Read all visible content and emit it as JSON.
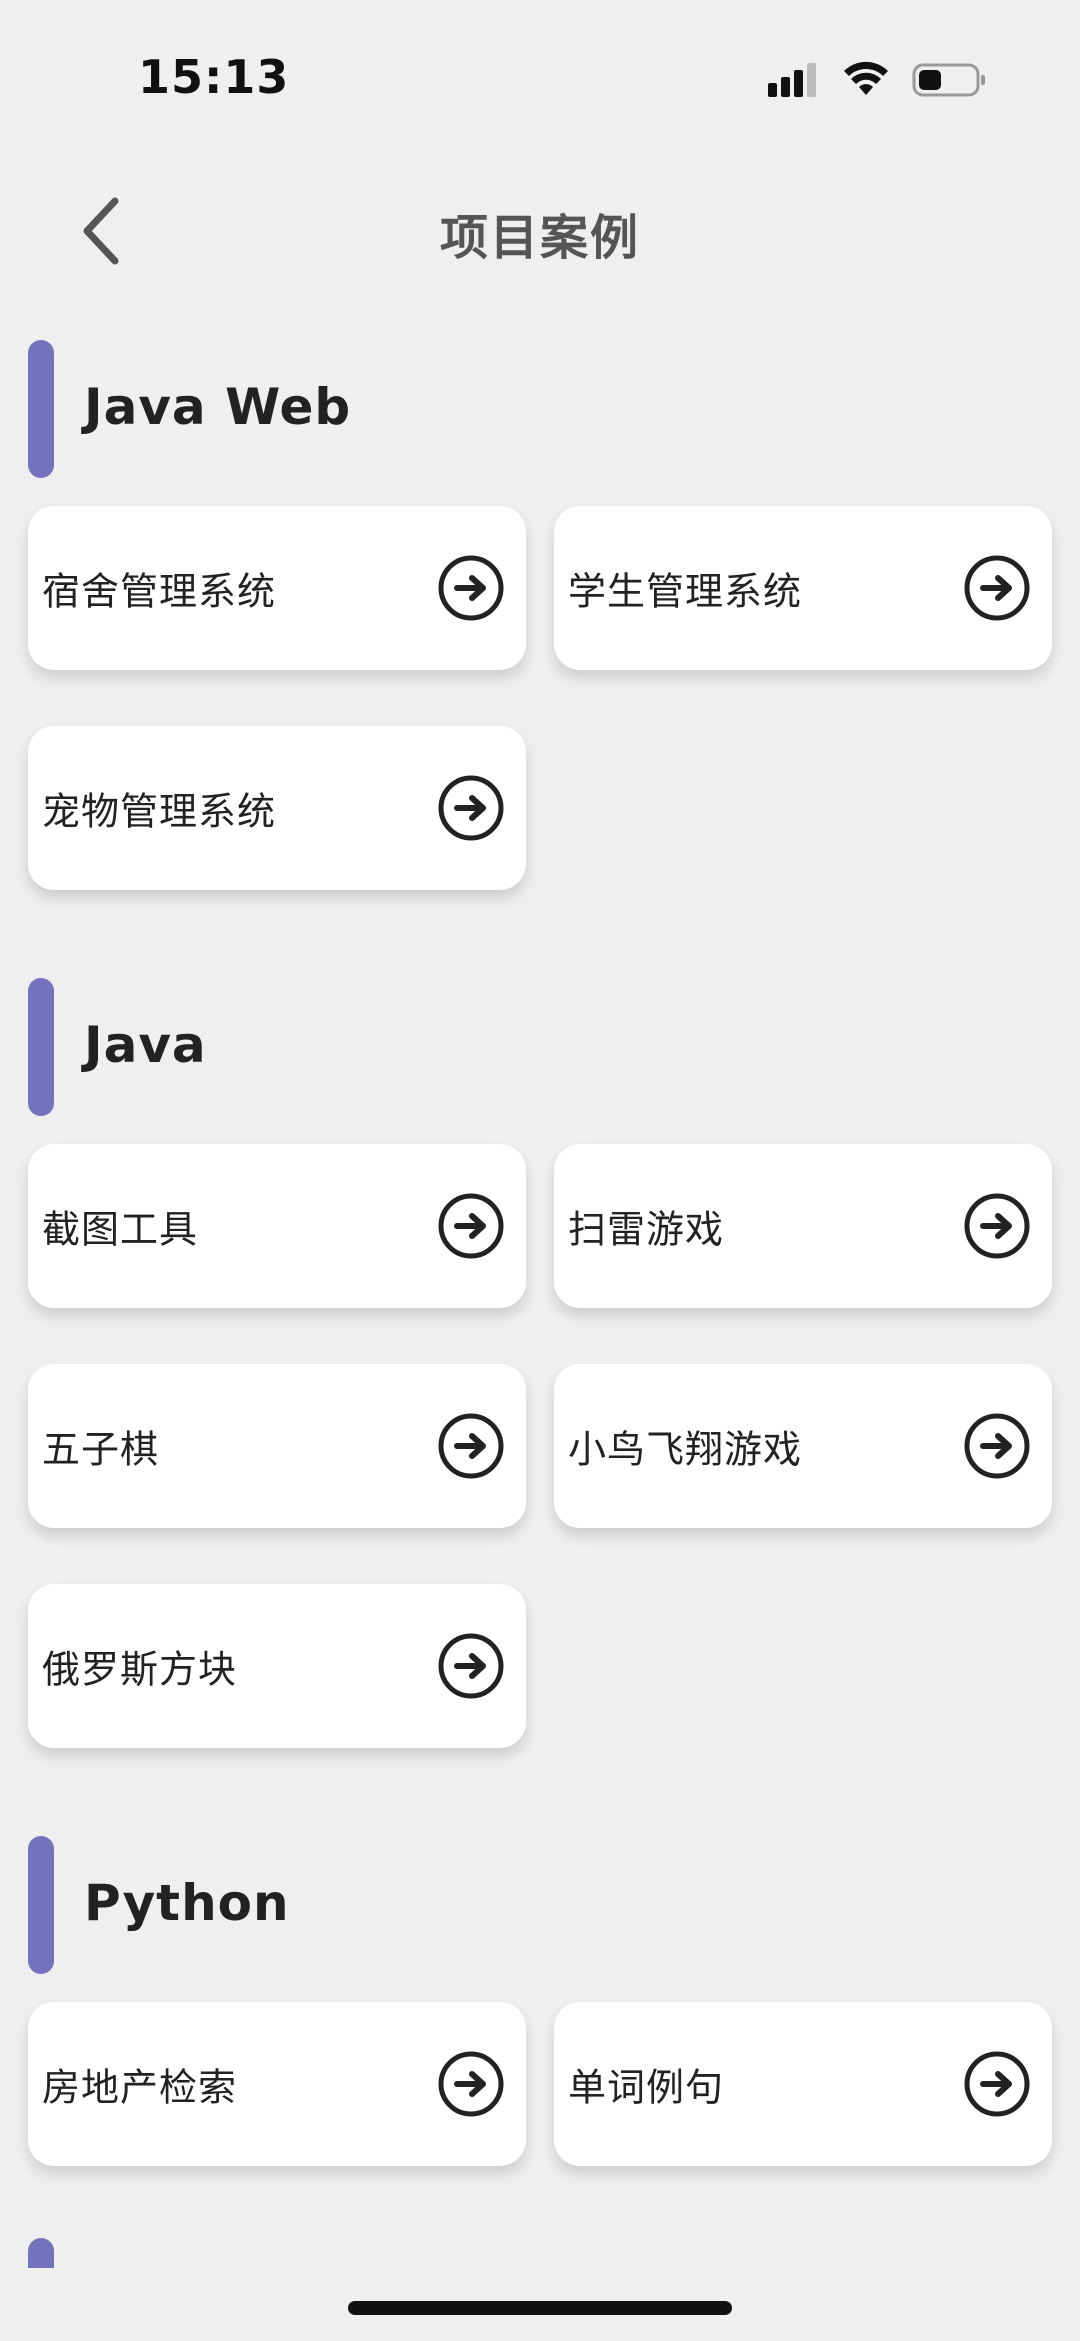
{
  "status_bar": {
    "time": "15:13",
    "icons": [
      "signal-icon",
      "wifi-icon",
      "battery-icon"
    ]
  },
  "nav": {
    "back_icon": "chevron-left-icon",
    "title": "项目案例"
  },
  "colors": {
    "accent": "#7471bd",
    "background": "#efefef",
    "card": "#ffffff",
    "text": "#222222"
  },
  "sections": [
    {
      "title": "Java Web",
      "items": [
        {
          "label": "宿舍管理系统"
        },
        {
          "label": "学生管理系统"
        },
        {
          "label": "宠物管理系统"
        }
      ]
    },
    {
      "title": "Java",
      "items": [
        {
          "label": "截图工具"
        },
        {
          "label": "扫雷游戏"
        },
        {
          "label": "五子棋"
        },
        {
          "label": "小鸟飞翔游戏"
        },
        {
          "label": "俄罗斯方块"
        }
      ]
    },
    {
      "title": "Python",
      "items": [
        {
          "label": "房地产检索"
        },
        {
          "label": "单词例句"
        }
      ]
    }
  ]
}
